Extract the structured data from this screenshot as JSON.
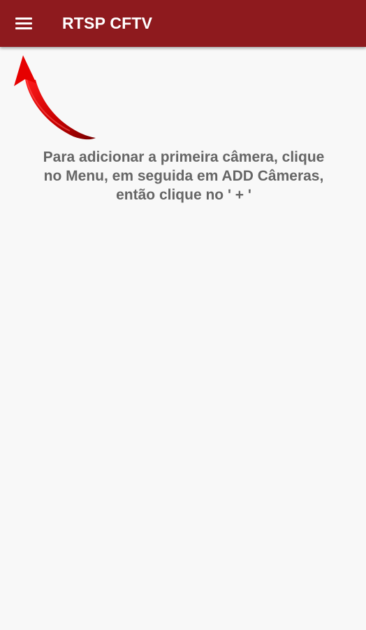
{
  "app_bar": {
    "title": "RTSP CFTV",
    "background_color": "#8e1a1e",
    "menu_icon": "hamburger-menu-icon"
  },
  "content": {
    "instruction": "Para adicionar a primeira câmera, clique no Menu, em seguida em ADD Câmeras, então clique no ' + '",
    "arrow_icon": "curved-arrow-pointing-to-menu"
  },
  "colors": {
    "accent": "#8e1a1e",
    "text": "#666666",
    "arrow": "#c40000"
  }
}
